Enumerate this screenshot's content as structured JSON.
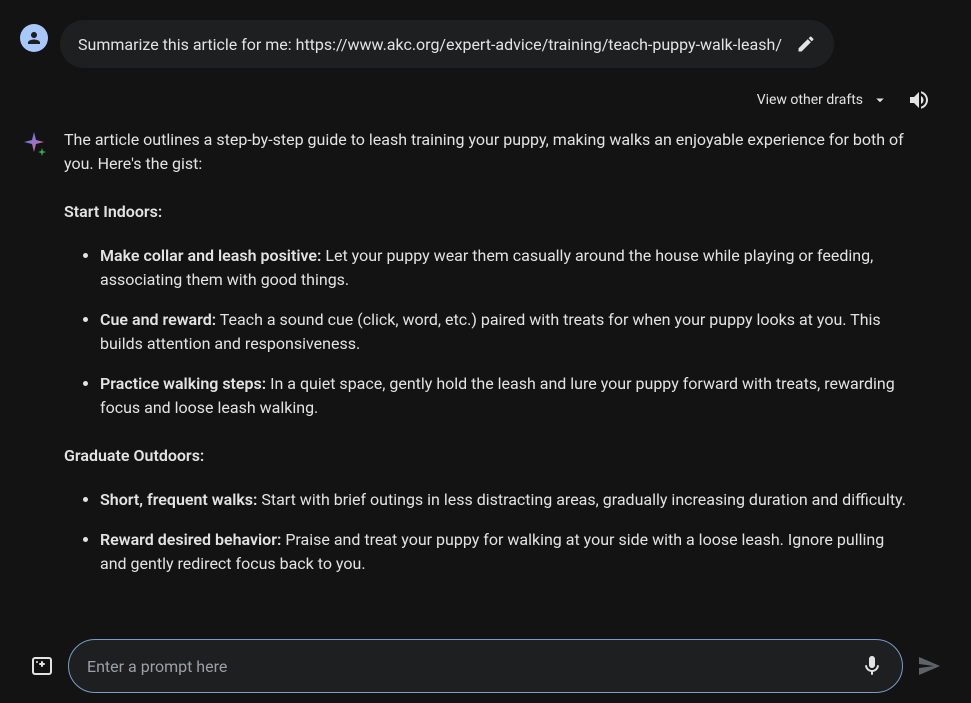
{
  "user_message": {
    "text": "Summarize this article for me: https://www.akc.org/expert-advice/training/teach-puppy-walk-leash/"
  },
  "drafts": {
    "label": "View other drafts"
  },
  "assistant": {
    "intro": "The article outlines a step-by-step guide to leash training your puppy, making walks an enjoyable experience for both of you. Here's the gist:",
    "sections": [
      {
        "title": "Start Indoors:",
        "bullets": [
          {
            "title": "Make collar and leash positive:",
            "text": " Let your puppy wear them casually around the house while playing or feeding, associating them with good things."
          },
          {
            "title": "Cue and reward:",
            "text": " Teach a sound cue (click, word, etc.) paired with treats for when your puppy looks at you. This builds attention and responsiveness."
          },
          {
            "title": "Practice walking steps:",
            "text": " In a quiet space, gently hold the leash and lure your puppy forward with treats, rewarding focus and loose leash walking."
          }
        ]
      },
      {
        "title": "Graduate Outdoors:",
        "bullets": [
          {
            "title": "Short, frequent walks:",
            "text": " Start with brief outings in less distracting areas, gradually increasing duration and difficulty."
          },
          {
            "title": "Reward desired behavior:",
            "text": " Praise and treat your puppy for walking at your side with a loose leash. Ignore pulling and gently redirect focus back to you."
          }
        ]
      }
    ]
  },
  "input": {
    "placeholder": "Enter a prompt here"
  }
}
